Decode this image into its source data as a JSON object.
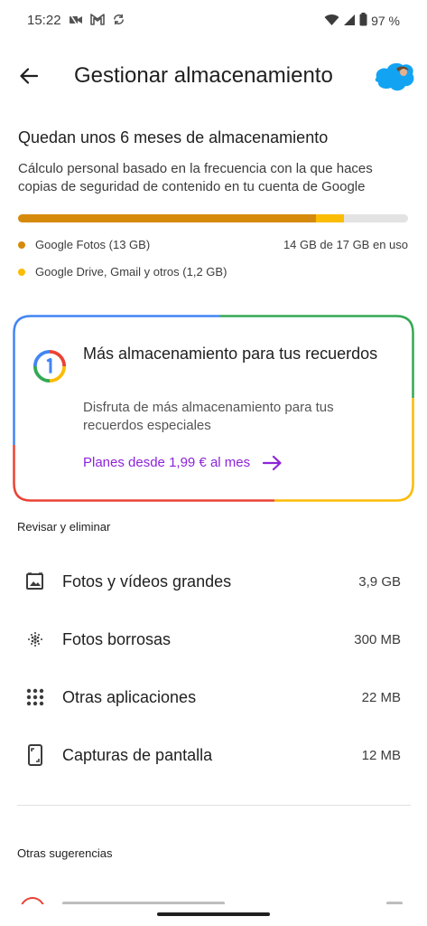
{
  "status_bar": {
    "time": "15:22",
    "battery": "97 %",
    "icons_left": [
      "missed-video-call-icon",
      "gmail-icon",
      "sync-icon"
    ],
    "icons_right": [
      "wifi-icon",
      "signal-icon",
      "battery-icon"
    ]
  },
  "app_bar": {
    "title": "Gestionar almacenamiento"
  },
  "summary": {
    "heading": "Quedan unos 6 meses de almacenamiento",
    "description": "Cálculo personal basado en la frecuencia con la que haces copias de seguridad de contenido en tu cuenta de Google",
    "usage": "14 GB de 17 GB en uso",
    "segments": [
      {
        "label": "Google Fotos (13 GB)",
        "gb": 13,
        "color": "#d68a0b"
      },
      {
        "label": "Google Drive, Gmail y otros (1,2 GB)",
        "gb": 1.2,
        "color": "#fbbc04"
      }
    ],
    "total_gb": 17
  },
  "promo": {
    "title": "Más almacenamiento para tus recuerdos",
    "description": "Disfruta de más almacenamiento para tus recuerdos especiales",
    "link": "Planes desde 1,99 € al mes",
    "link_color": "#8e24d8"
  },
  "review": {
    "header": "Revisar y eliminar",
    "items": [
      {
        "label": "Fotos y vídeos grandes",
        "size": "3,9 GB",
        "icon": "large-photos-icon"
      },
      {
        "label": "Fotos borrosas",
        "size": "300 MB",
        "icon": "blurry-photos-icon"
      },
      {
        "label": "Otras aplicaciones",
        "size": "22 MB",
        "icon": "apps-grid-icon"
      },
      {
        "label": "Capturas de pantalla",
        "size": "12 MB",
        "icon": "screenshot-icon"
      }
    ]
  },
  "suggestions": {
    "header": "Otras sugerencias"
  }
}
